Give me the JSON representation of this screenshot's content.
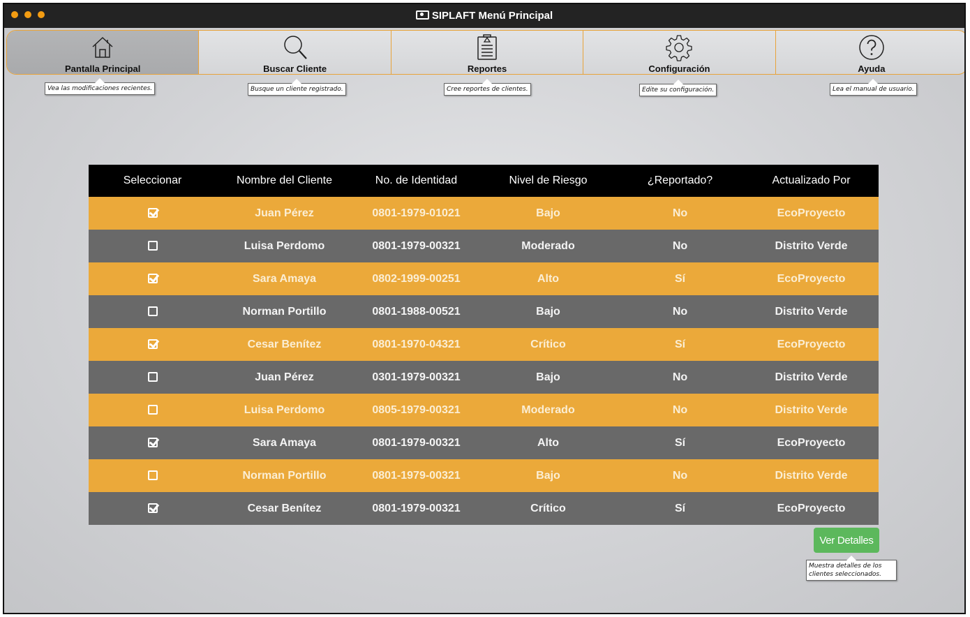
{
  "window": {
    "title": "SIPLAFT Menú Principal",
    "title_icon": "money-icon"
  },
  "nav": [
    {
      "label": "Pantalla Principal",
      "icon": "home-icon",
      "tooltip": "Vea las modificaciones recientes.",
      "active": true
    },
    {
      "label": "Buscar Cliente",
      "icon": "search-icon",
      "tooltip": "Busque un cliente registrado.",
      "active": false
    },
    {
      "label": "Reportes",
      "icon": "clipboard-icon",
      "tooltip": "Cree reportes de clientes.",
      "active": false
    },
    {
      "label": "Configuración",
      "icon": "gear-icon",
      "tooltip": "Edite su configuración.",
      "active": false
    },
    {
      "label": "Ayuda",
      "icon": "help-icon",
      "tooltip": "Lea el manual de usuario.",
      "active": false
    }
  ],
  "table": {
    "headers": [
      "Seleccionar",
      "Nombre del Cliente",
      "No. de Identidad",
      "Nivel de Riesgo",
      "¿Reportado?",
      "Actualizado Por"
    ],
    "rows": [
      {
        "selected": true,
        "name": "Juan Pérez",
        "id": "0801-1979-01021",
        "risk": "Bajo",
        "reported": "No",
        "updated_by": "EcoProyecto"
      },
      {
        "selected": false,
        "name": "Luisa Perdomo",
        "id": "0801-1979-00321",
        "risk": "Moderado",
        "reported": "No",
        "updated_by": "Distrito Verde"
      },
      {
        "selected": true,
        "name": "Sara Amaya",
        "id": "0802-1999-00251",
        "risk": "Alto",
        "reported": "Sí",
        "updated_by": "EcoProyecto"
      },
      {
        "selected": false,
        "name": "Norman Portillo",
        "id": "0801-1988-00521",
        "risk": "Bajo",
        "reported": "No",
        "updated_by": "Distrito Verde"
      },
      {
        "selected": true,
        "name": "Cesar Benítez",
        "id": "0801-1970-04321",
        "risk": "Crítico",
        "reported": "Sí",
        "updated_by": "EcoProyecto"
      },
      {
        "selected": false,
        "name": "Juan Pérez",
        "id": "0301-1979-00321",
        "risk": "Bajo",
        "reported": "No",
        "updated_by": "Distrito Verde"
      },
      {
        "selected": false,
        "name": "Luisa Perdomo",
        "id": "0805-1979-00321",
        "risk": "Moderado",
        "reported": "No",
        "updated_by": "Distrito Verde"
      },
      {
        "selected": true,
        "name": "Sara Amaya",
        "id": "0801-1979-00321",
        "risk": "Alto",
        "reported": "Sí",
        "updated_by": "EcoProyecto"
      },
      {
        "selected": false,
        "name": "Norman Portillo",
        "id": "0801-1979-00321",
        "risk": "Bajo",
        "reported": "No",
        "updated_by": "Distrito Verde"
      },
      {
        "selected": true,
        "name": "Cesar Benítez",
        "id": "0801-1979-00321",
        "risk": "Crítico",
        "reported": "Sí",
        "updated_by": "EcoProyecto"
      }
    ]
  },
  "details_button": {
    "label": "Ver Detalles",
    "tooltip": "Muestra detalles de los clientes seleccionados."
  },
  "colors": {
    "accent_orange": "#eba93a",
    "row_gray": "#696969",
    "header_black": "#000000",
    "button_green": "#5cb85c",
    "titlebar": "#232323"
  }
}
